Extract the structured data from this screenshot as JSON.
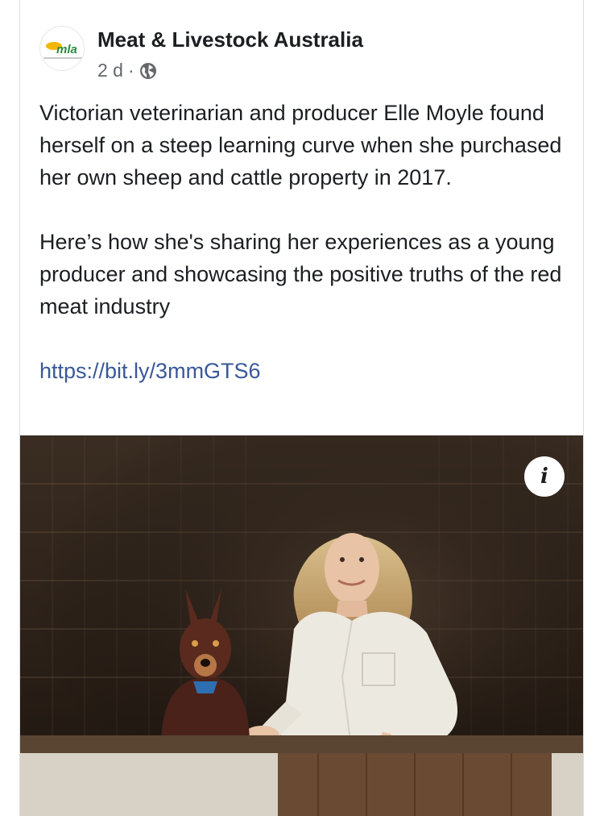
{
  "post": {
    "page_name": "Meat & Livestock Australia",
    "avatar_logo_text": "mla",
    "timestamp": "2 d",
    "separator": "·",
    "privacy_icon": "globe-icon",
    "paragraph1": "Victorian veterinarian and producer Elle Moyle found herself on a steep learning curve when she purchased her own sheep and cattle property in 2017.",
    "paragraph2": "Here’s how she's sharing her experiences as a young producer and showcasing the positive truths of the red meat industry",
    "link": "https://bit.ly/3mmGTS6"
  },
  "photo": {
    "info_label": "i",
    "info_icon": "info-icon"
  },
  "colors": {
    "link": "#385898",
    "text": "#1c1e21",
    "secondary_text": "#65676b"
  }
}
